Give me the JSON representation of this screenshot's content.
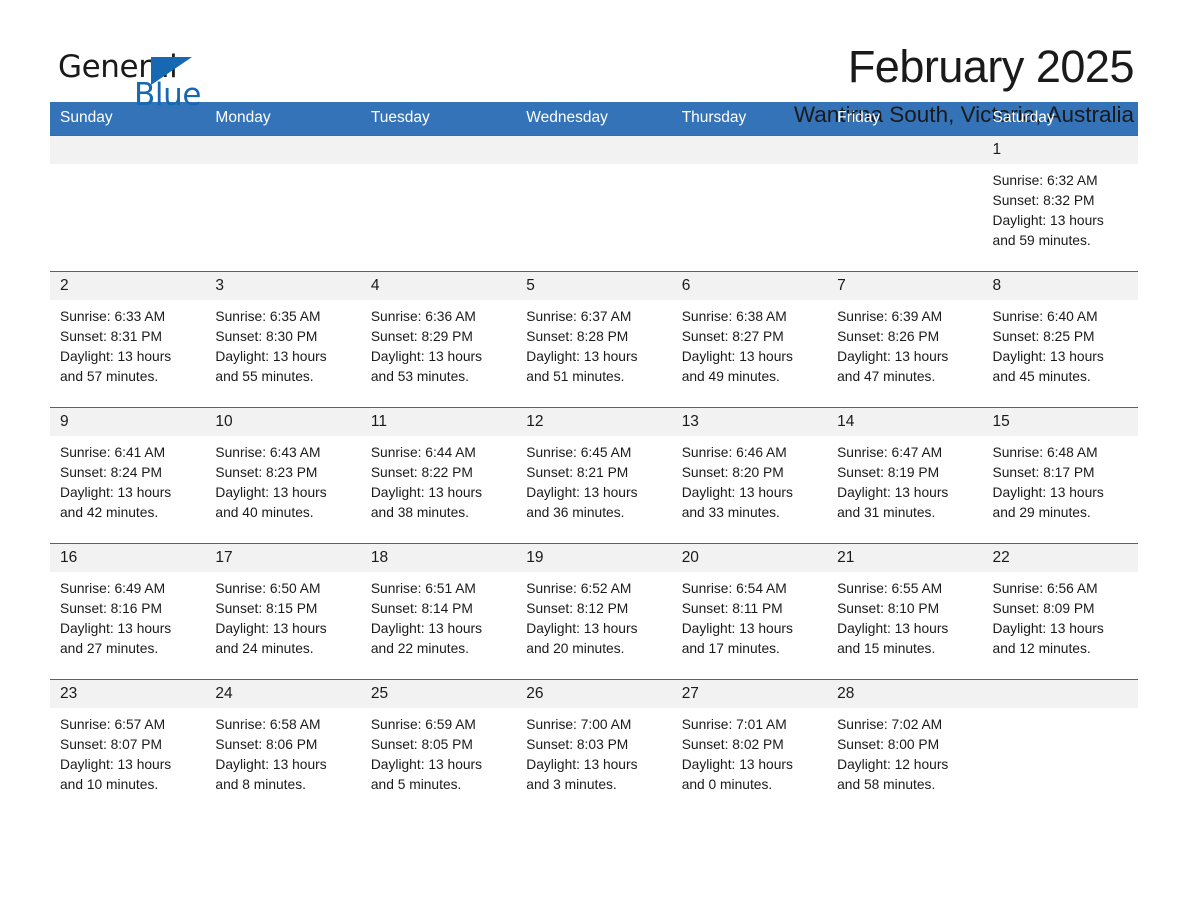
{
  "logo": {
    "word1": "General",
    "word2": "Blue",
    "triangle": "blue-triangle-icon",
    "accent_color": "#1668b3"
  },
  "header": {
    "title": "February 2025",
    "location": "Wantirna South, Victoria, Australia"
  },
  "colors": {
    "header_row": "#3573b9",
    "daynum_strip": "#f2f2f2",
    "cell_border": "#2f6da9",
    "text": "#1a1a1a"
  },
  "calendar": {
    "weekday_headers": [
      "Sunday",
      "Monday",
      "Tuesday",
      "Wednesday",
      "Thursday",
      "Friday",
      "Saturday"
    ],
    "weeks": [
      [
        {
          "day": "",
          "lines": []
        },
        {
          "day": "",
          "lines": []
        },
        {
          "day": "",
          "lines": []
        },
        {
          "day": "",
          "lines": []
        },
        {
          "day": "",
          "lines": []
        },
        {
          "day": "",
          "lines": []
        },
        {
          "day": "1",
          "lines": [
            "Sunrise: 6:32 AM",
            "Sunset: 8:32 PM",
            "Daylight: 13 hours",
            "and 59 minutes."
          ]
        }
      ],
      [
        {
          "day": "2",
          "lines": [
            "Sunrise: 6:33 AM",
            "Sunset: 8:31 PM",
            "Daylight: 13 hours",
            "and 57 minutes."
          ]
        },
        {
          "day": "3",
          "lines": [
            "Sunrise: 6:35 AM",
            "Sunset: 8:30 PM",
            "Daylight: 13 hours",
            "and 55 minutes."
          ]
        },
        {
          "day": "4",
          "lines": [
            "Sunrise: 6:36 AM",
            "Sunset: 8:29 PM",
            "Daylight: 13 hours",
            "and 53 minutes."
          ]
        },
        {
          "day": "5",
          "lines": [
            "Sunrise: 6:37 AM",
            "Sunset: 8:28 PM",
            "Daylight: 13 hours",
            "and 51 minutes."
          ]
        },
        {
          "day": "6",
          "lines": [
            "Sunrise: 6:38 AM",
            "Sunset: 8:27 PM",
            "Daylight: 13 hours",
            "and 49 minutes."
          ]
        },
        {
          "day": "7",
          "lines": [
            "Sunrise: 6:39 AM",
            "Sunset: 8:26 PM",
            "Daylight: 13 hours",
            "and 47 minutes."
          ]
        },
        {
          "day": "8",
          "lines": [
            "Sunrise: 6:40 AM",
            "Sunset: 8:25 PM",
            "Daylight: 13 hours",
            "and 45 minutes."
          ]
        }
      ],
      [
        {
          "day": "9",
          "lines": [
            "Sunrise: 6:41 AM",
            "Sunset: 8:24 PM",
            "Daylight: 13 hours",
            "and 42 minutes."
          ]
        },
        {
          "day": "10",
          "lines": [
            "Sunrise: 6:43 AM",
            "Sunset: 8:23 PM",
            "Daylight: 13 hours",
            "and 40 minutes."
          ]
        },
        {
          "day": "11",
          "lines": [
            "Sunrise: 6:44 AM",
            "Sunset: 8:22 PM",
            "Daylight: 13 hours",
            "and 38 minutes."
          ]
        },
        {
          "day": "12",
          "lines": [
            "Sunrise: 6:45 AM",
            "Sunset: 8:21 PM",
            "Daylight: 13 hours",
            "and 36 minutes."
          ]
        },
        {
          "day": "13",
          "lines": [
            "Sunrise: 6:46 AM",
            "Sunset: 8:20 PM",
            "Daylight: 13 hours",
            "and 33 minutes."
          ]
        },
        {
          "day": "14",
          "lines": [
            "Sunrise: 6:47 AM",
            "Sunset: 8:19 PM",
            "Daylight: 13 hours",
            "and 31 minutes."
          ]
        },
        {
          "day": "15",
          "lines": [
            "Sunrise: 6:48 AM",
            "Sunset: 8:17 PM",
            "Daylight: 13 hours",
            "and 29 minutes."
          ]
        }
      ],
      [
        {
          "day": "16",
          "lines": [
            "Sunrise: 6:49 AM",
            "Sunset: 8:16 PM",
            "Daylight: 13 hours",
            "and 27 minutes."
          ]
        },
        {
          "day": "17",
          "lines": [
            "Sunrise: 6:50 AM",
            "Sunset: 8:15 PM",
            "Daylight: 13 hours",
            "and 24 minutes."
          ]
        },
        {
          "day": "18",
          "lines": [
            "Sunrise: 6:51 AM",
            "Sunset: 8:14 PM",
            "Daylight: 13 hours",
            "and 22 minutes."
          ]
        },
        {
          "day": "19",
          "lines": [
            "Sunrise: 6:52 AM",
            "Sunset: 8:12 PM",
            "Daylight: 13 hours",
            "and 20 minutes."
          ]
        },
        {
          "day": "20",
          "lines": [
            "Sunrise: 6:54 AM",
            "Sunset: 8:11 PM",
            "Daylight: 13 hours",
            "and 17 minutes."
          ]
        },
        {
          "day": "21",
          "lines": [
            "Sunrise: 6:55 AM",
            "Sunset: 8:10 PM",
            "Daylight: 13 hours",
            "and 15 minutes."
          ]
        },
        {
          "day": "22",
          "lines": [
            "Sunrise: 6:56 AM",
            "Sunset: 8:09 PM",
            "Daylight: 13 hours",
            "and 12 minutes."
          ]
        }
      ],
      [
        {
          "day": "23",
          "lines": [
            "Sunrise: 6:57 AM",
            "Sunset: 8:07 PM",
            "Daylight: 13 hours",
            "and 10 minutes."
          ]
        },
        {
          "day": "24",
          "lines": [
            "Sunrise: 6:58 AM",
            "Sunset: 8:06 PM",
            "Daylight: 13 hours",
            "and 8 minutes."
          ]
        },
        {
          "day": "25",
          "lines": [
            "Sunrise: 6:59 AM",
            "Sunset: 8:05 PM",
            "Daylight: 13 hours",
            "and 5 minutes."
          ]
        },
        {
          "day": "26",
          "lines": [
            "Sunrise: 7:00 AM",
            "Sunset: 8:03 PM",
            "Daylight: 13 hours",
            "and 3 minutes."
          ]
        },
        {
          "day": "27",
          "lines": [
            "Sunrise: 7:01 AM",
            "Sunset: 8:02 PM",
            "Daylight: 13 hours",
            "and 0 minutes."
          ]
        },
        {
          "day": "28",
          "lines": [
            "Sunrise: 7:02 AM",
            "Sunset: 8:00 PM",
            "Daylight: 12 hours",
            "and 58 minutes."
          ]
        },
        {
          "day": "",
          "lines": []
        }
      ]
    ]
  }
}
